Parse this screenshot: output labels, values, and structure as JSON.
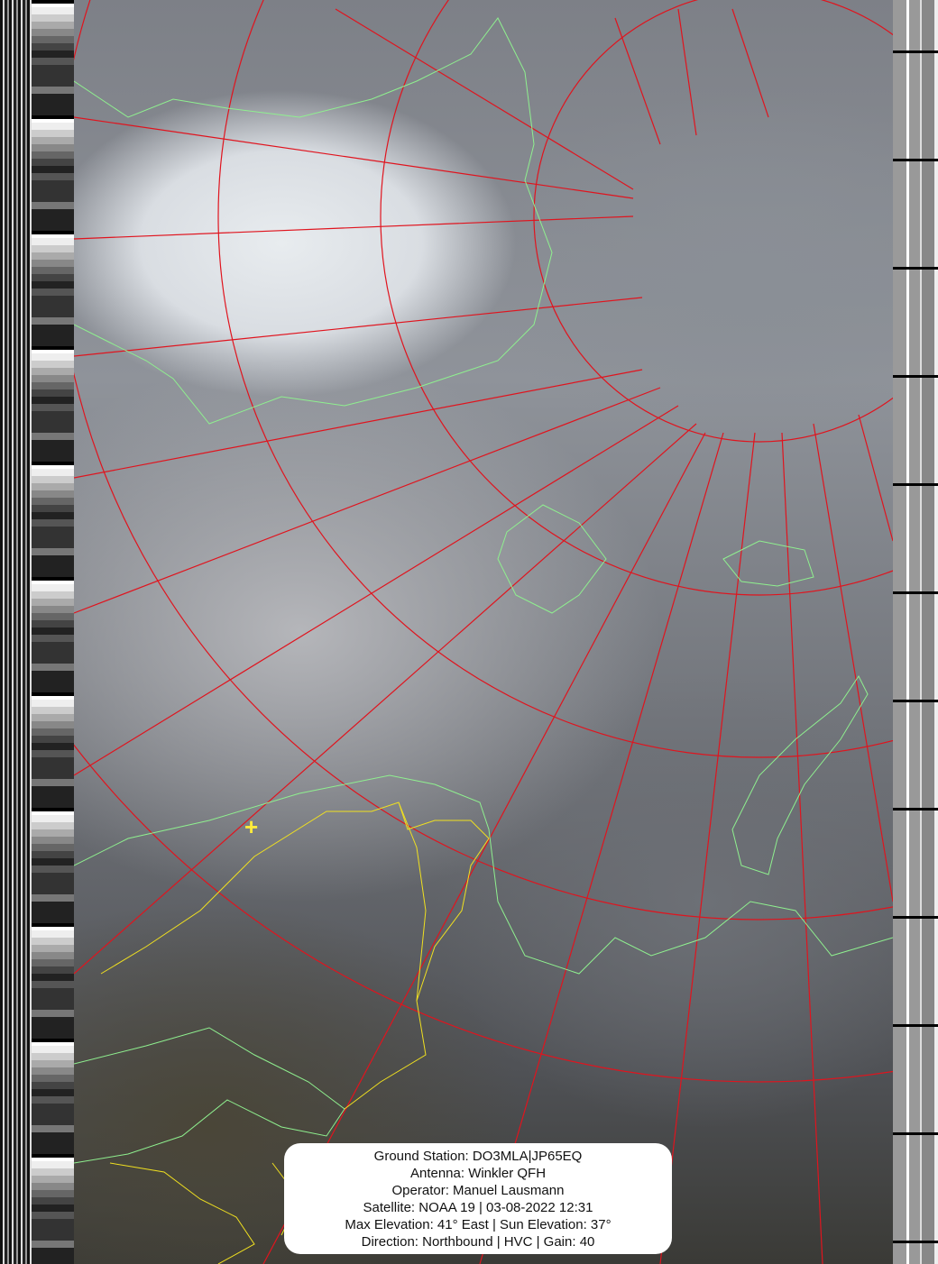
{
  "info": {
    "ground_station": "Ground Station: DO3MLA|JP65EQ",
    "antenna": "Antenna: Winkler QFH",
    "operator": "Operator: Manuel Lausmann",
    "satellite": "Satellite: NOAA 19 | 03-08-2022 12:31",
    "elevation": "Max Elevation: 41° East | Sun Elevation: 37°",
    "direction": "Direction: Northbound | HVC | Gain: 40"
  },
  "overlay_colors": {
    "graticule": "#e0141e",
    "coastline": "#8ff08f",
    "borders": "#f0e020",
    "station_marker": "#ffeb3b"
  },
  "station_marker_icon": "plus-icon"
}
